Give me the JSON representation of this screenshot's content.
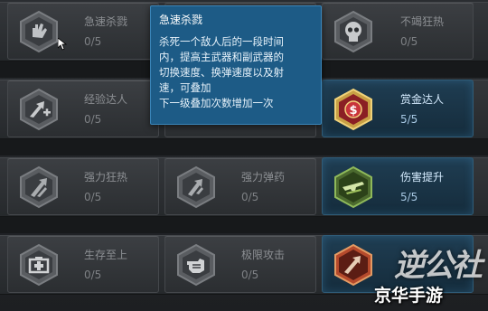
{
  "skills": [
    {
      "id": "rapid-kill",
      "name": "急速杀戮",
      "count": "0/5",
      "active": false,
      "icon": "hand-icon"
    },
    {
      "id": "unknown-2",
      "name": "",
      "count": "",
      "active": false,
      "icon": "blank-icon"
    },
    {
      "id": "undying-frenzy",
      "name": "不竭狂热",
      "count": "0/5",
      "active": false,
      "icon": "skull-icon"
    },
    {
      "id": "expert-experience",
      "name": "经验达人",
      "count": "0/5",
      "active": false,
      "icon": "plus-arrow-icon"
    },
    {
      "id": "unknown-5",
      "name": "",
      "count": "",
      "active": false,
      "icon": "blank-icon"
    },
    {
      "id": "bounty-expert",
      "name": "赏金达人",
      "count": "5/5",
      "active": true,
      "icon": "dollar-badge-icon"
    },
    {
      "id": "power-frenzy",
      "name": "强力狂热",
      "count": "0/5",
      "active": false,
      "icon": "slash-arrow-icon"
    },
    {
      "id": "power-ammo",
      "name": "强力弹药",
      "count": "0/5",
      "active": false,
      "icon": "ammo-arrow-icon"
    },
    {
      "id": "damage-boost",
      "name": "伤害提升",
      "count": "5/5",
      "active": true,
      "icon": "gun-icon"
    },
    {
      "id": "survival-first",
      "name": "生存至上",
      "count": "0/5",
      "active": false,
      "icon": "medkit-icon"
    },
    {
      "id": "extreme-attack",
      "name": "极限攻击",
      "count": "0/5",
      "active": false,
      "icon": "fist-icon"
    },
    {
      "id": "rapid-reload",
      "name": "",
      "count": "",
      "active": true,
      "icon": "reload-icon"
    }
  ],
  "tooltip": {
    "title": "急速杀戮",
    "line1": "杀死一个敌人后的一段时间",
    "line2": "内，提高主武器和副武器的",
    "line3": "切换速度、换弹速度以及射",
    "line4": "速，可叠加",
    "next": "下一级叠加次数增加一次"
  },
  "watermark": {
    "brand": "京华手游",
    "logo": "逆公社"
  },
  "colors": {
    "tooltip_bg": "#1d5b86",
    "active_card": "#1f3d52",
    "inactive_card": "#3c3f43"
  }
}
